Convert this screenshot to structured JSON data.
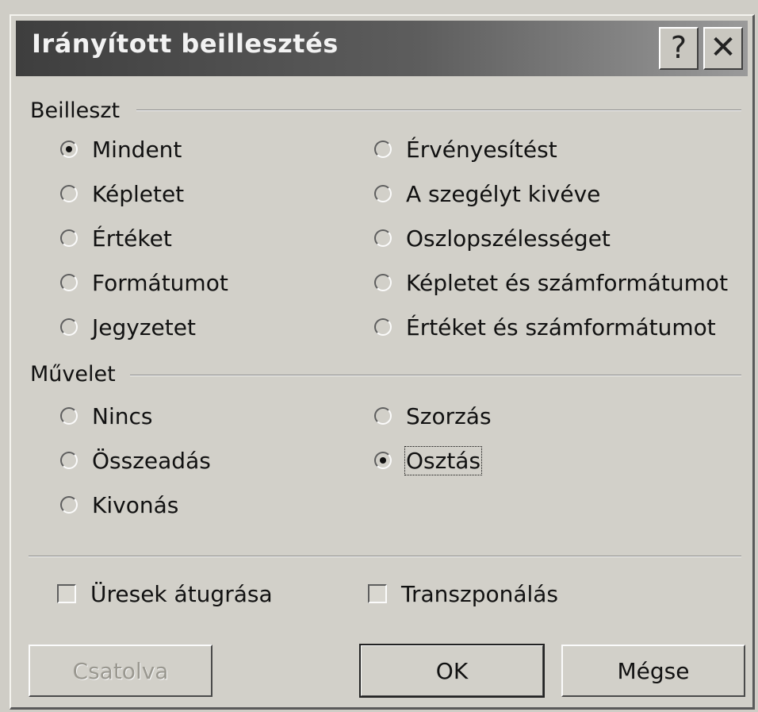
{
  "window": {
    "title": "Irányított beillesztés",
    "help_glyph": "?",
    "close_glyph": "✕"
  },
  "paste_group": {
    "label": "Beilleszt",
    "options_left": [
      "Mindent",
      "Képletet",
      "Értéket",
      "Formátumot",
      "Jegyzetet"
    ],
    "options_right": [
      "Érvényesítést",
      "A szegélyt kivéve",
      "Oszlopszélességet",
      "Képletet és számformátumot",
      "Értéket és számformátumot"
    ],
    "selected": "Mindent"
  },
  "operation_group": {
    "label": "Művelet",
    "options_left": [
      "Nincs",
      "Összeadás",
      "Kivonás"
    ],
    "options_right": [
      "Szorzás",
      "Osztás"
    ],
    "selected": "Osztás"
  },
  "checkboxes": {
    "skip_blanks": "Üresek átugrása",
    "transpose": "Transzponálás"
  },
  "buttons": {
    "paste_link": "Csatolva",
    "ok": "OK",
    "cancel": "Mégse"
  }
}
